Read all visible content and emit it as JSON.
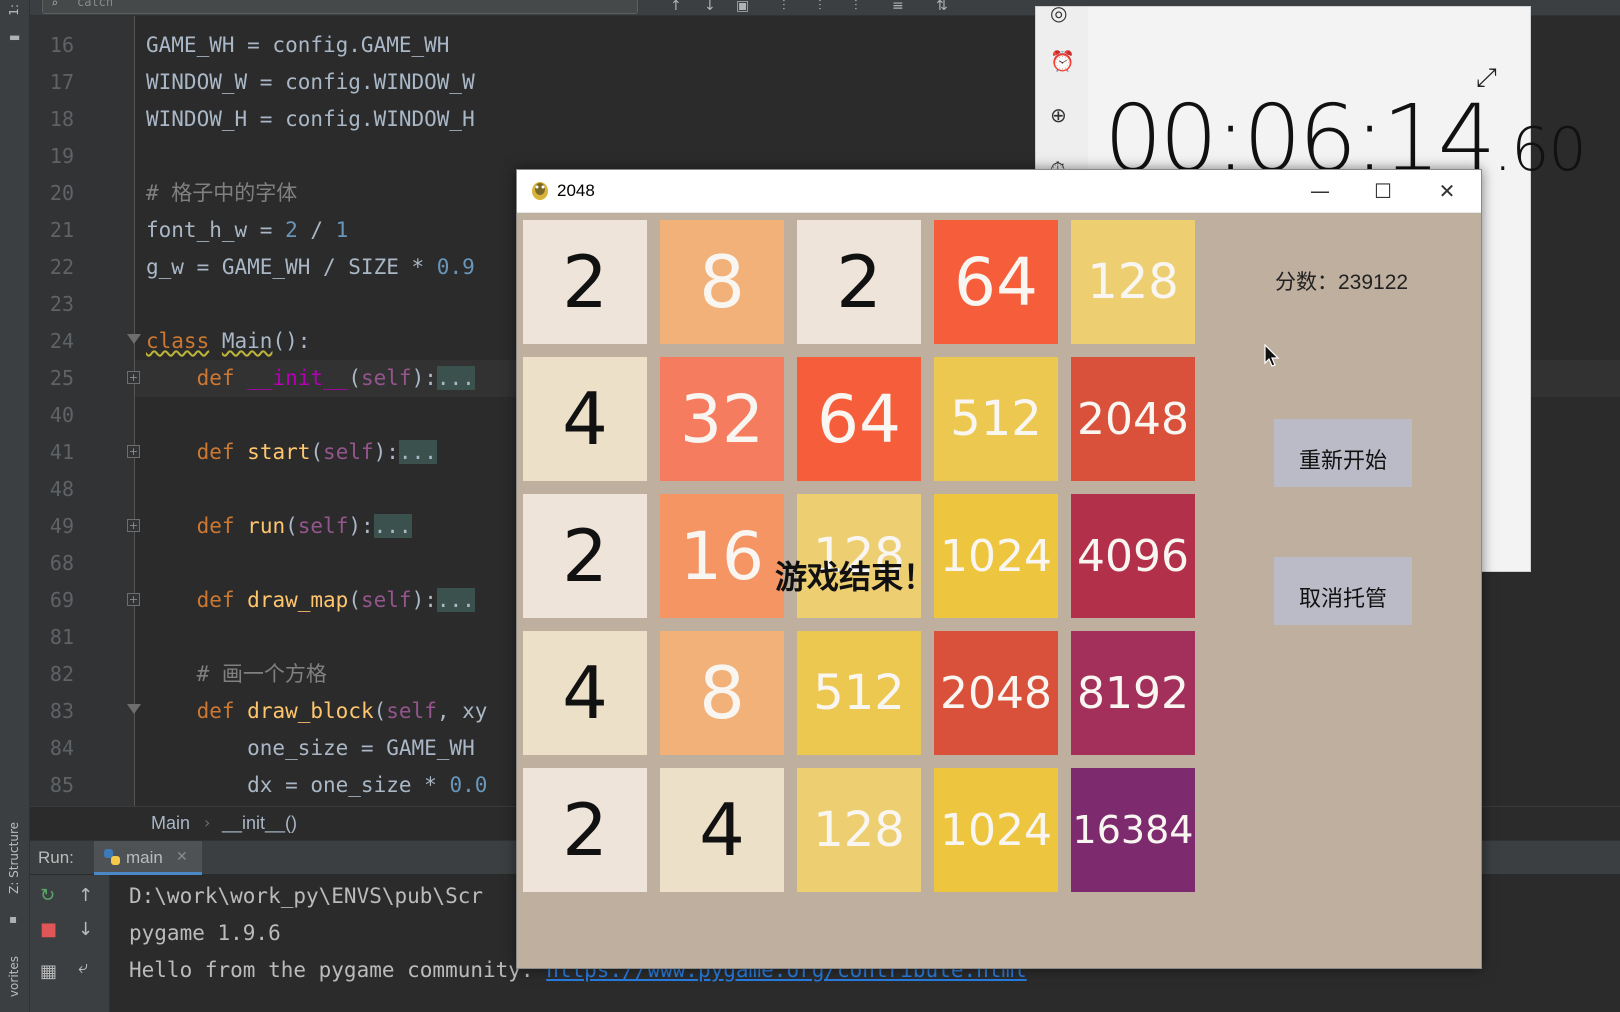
{
  "ide": {
    "search_placeholder": "catch",
    "side_tabs": [
      "1:",
      "Z: Structure",
      "vorites"
    ],
    "code_lines": [
      {
        "ln": "16",
        "segments": [
          {
            "t": "GAME_WH = config.GAME_WH",
            "c": ""
          }
        ]
      },
      {
        "ln": "17",
        "segments": [
          {
            "t": "WINDOW_W = config.WINDOW_W",
            "c": ""
          }
        ]
      },
      {
        "ln": "18",
        "segments": [
          {
            "t": "WINDOW_H = config.WINDOW_H",
            "c": ""
          }
        ]
      },
      {
        "ln": "19",
        "segments": []
      },
      {
        "ln": "20",
        "segments": [
          {
            "t": "# 格子中的字体",
            "c": "cmt"
          }
        ]
      },
      {
        "ln": "21",
        "segments": [
          {
            "t": "font_h_w = ",
            "c": ""
          },
          {
            "t": "2",
            "c": "num"
          },
          {
            "t": " / ",
            "c": ""
          },
          {
            "t": "1",
            "c": "num"
          }
        ]
      },
      {
        "ln": "22",
        "segments": [
          {
            "t": "g_w = GAME_WH / SIZE * ",
            "c": ""
          },
          {
            "t": "0.9",
            "c": "num"
          }
        ]
      },
      {
        "ln": "23",
        "segments": []
      },
      {
        "ln": "24",
        "fold": "tri",
        "segments": [
          {
            "t": "class",
            "c": "kw squig"
          },
          {
            "t": " ",
            "c": ""
          },
          {
            "t": "Main",
            "c": "squig"
          },
          {
            "t": "():",
            "c": ""
          }
        ]
      },
      {
        "ln": "25",
        "fold": "box",
        "caret": true,
        "segments": [
          {
            "t": "    ",
            "c": ""
          },
          {
            "t": "def",
            "c": "kw"
          },
          {
            "t": " ",
            "c": ""
          },
          {
            "t": "__init__",
            "c": "magic"
          },
          {
            "t": "(",
            "c": ""
          },
          {
            "t": "self",
            "c": "self"
          },
          {
            "t": "):",
            "c": ""
          },
          {
            "t": "...",
            "c": "fold-dots"
          }
        ]
      },
      {
        "ln": "40",
        "segments": []
      },
      {
        "ln": "41",
        "fold": "box",
        "segments": [
          {
            "t": "    ",
            "c": ""
          },
          {
            "t": "def",
            "c": "kw"
          },
          {
            "t": " ",
            "c": ""
          },
          {
            "t": "start",
            "c": "fn"
          },
          {
            "t": "(",
            "c": ""
          },
          {
            "t": "self",
            "c": "self"
          },
          {
            "t": "):",
            "c": ""
          },
          {
            "t": "...",
            "c": "fold-dots"
          }
        ]
      },
      {
        "ln": "48",
        "segments": []
      },
      {
        "ln": "49",
        "fold": "box",
        "segments": [
          {
            "t": "    ",
            "c": ""
          },
          {
            "t": "def",
            "c": "kw"
          },
          {
            "t": " ",
            "c": ""
          },
          {
            "t": "run",
            "c": "fn"
          },
          {
            "t": "(",
            "c": ""
          },
          {
            "t": "self",
            "c": "self"
          },
          {
            "t": "):",
            "c": ""
          },
          {
            "t": "...",
            "c": "fold-dots"
          }
        ]
      },
      {
        "ln": "68",
        "segments": []
      },
      {
        "ln": "69",
        "fold": "box",
        "segments": [
          {
            "t": "    ",
            "c": ""
          },
          {
            "t": "def",
            "c": "kw"
          },
          {
            "t": " ",
            "c": ""
          },
          {
            "t": "draw_map",
            "c": "fn"
          },
          {
            "t": "(",
            "c": ""
          },
          {
            "t": "self",
            "c": "self"
          },
          {
            "t": "):",
            "c": ""
          },
          {
            "t": "...",
            "c": "fold-dots"
          }
        ]
      },
      {
        "ln": "81",
        "segments": []
      },
      {
        "ln": "82",
        "segments": [
          {
            "t": "    ",
            "c": ""
          },
          {
            "t": "# 画一个方格",
            "c": "cmt"
          }
        ]
      },
      {
        "ln": "83",
        "fold": "tri",
        "segments": [
          {
            "t": "    ",
            "c": ""
          },
          {
            "t": "def",
            "c": "kw"
          },
          {
            "t": " ",
            "c": ""
          },
          {
            "t": "draw_block",
            "c": "fn"
          },
          {
            "t": "(",
            "c": ""
          },
          {
            "t": "self",
            "c": "self"
          },
          {
            "t": ", xy",
            "c": ""
          }
        ]
      },
      {
        "ln": "84",
        "segments": [
          {
            "t": "        one_size = GAME_WH",
            "c": ""
          }
        ]
      },
      {
        "ln": "85",
        "segments": [
          {
            "t": "        dx = one_size * ",
            "c": ""
          },
          {
            "t": "0.0",
            "c": "num"
          }
        ]
      }
    ],
    "breadcrumb": [
      "Main",
      "__init__()"
    ],
    "run": {
      "label": "Run:",
      "tab": "main",
      "console": [
        {
          "text": "D:\\work\\work_py\\ENVS\\pub\\Scr",
          "link": ""
        },
        {
          "text": "pygame 1.9.6",
          "link": ""
        },
        {
          "text": "Hello from the pygame community. ",
          "link": "https://www.pygame.org/contribute.html"
        }
      ]
    }
  },
  "clock": {
    "time_main": "00:06:14",
    "time_fraction": ".60"
  },
  "game": {
    "title": "2048",
    "score_text": "分数：239122",
    "restart_label": "重新开始",
    "cancel_label": "取消托管",
    "game_over_text": "游戏结束！",
    "board": [
      [
        2,
        8,
        2,
        64,
        128
      ],
      [
        4,
        32,
        64,
        512,
        2048
      ],
      [
        2,
        16,
        128,
        1024,
        4096
      ],
      [
        4,
        8,
        512,
        2048,
        8192
      ],
      [
        2,
        4,
        128,
        1024,
        16384
      ]
    ],
    "tile_colors": {
      "2": "#eee4da",
      "4": "#ede0c8",
      "8": "#f2b179",
      "16": "#f59563",
      "32": "#f67c5f",
      "64": "#f65e3b",
      "128": "#edcf72",
      "512": "#edc850",
      "1024": "#edc53f",
      "2048": "#d9503b",
      "4096": "#b3304a",
      "8192": "#a3305a",
      "16384": "#7d2a6e"
    },
    "dark_text_values": [
      2,
      4
    ],
    "colors": {
      "background": "#beaf9e",
      "button": "#bbbbc7"
    }
  }
}
